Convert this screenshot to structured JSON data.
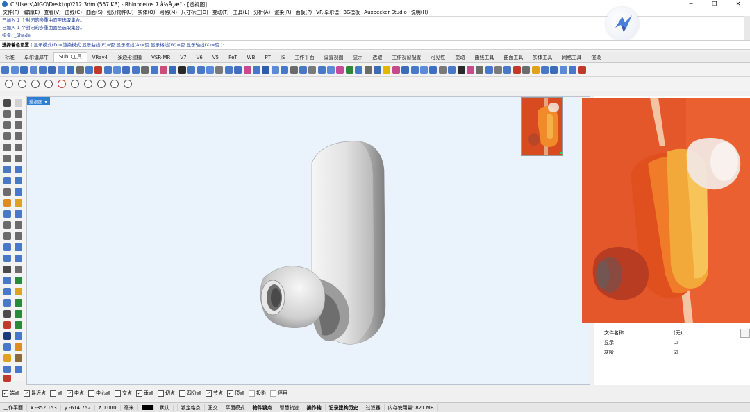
{
  "window": {
    "title": "C:\\Users\\AIGO\\Desktop\\212.3dm (557 KB) - Rhinoceros 7 å¼å¸æ° - [透视图]",
    "controls": [
      "─",
      "❐",
      "✕"
    ]
  },
  "menu": [
    "文件(F)",
    "编辑(E)",
    "查看(V)",
    "曲线(C)",
    "曲面(S)",
    "细分物件(U)",
    "实体(O)",
    "网格(M)",
    "尺寸标注(D)",
    "变动(T)",
    "工具(L)",
    "分析(A)",
    "渲染(R)",
    "面板(P)",
    "VR-卓尔谟",
    "BG模板",
    "Auxpecker Studio",
    "说明(H)"
  ],
  "command_history": [
    "已加入 1 个封闭的多重曲面至选取集合。",
    "已加入 1 个封闭的多重曲面至选取集合。",
    "指令: _Shade"
  ],
  "command_prompt": {
    "label": "选择着色设置",
    "options": "( 显示模式(D)=渲染模式  显示曲线(E)=否  显示框线(A)=否  显示格线(W)=否  显示轴线(X)=否 ):"
  },
  "tabs": [
    "标准",
    "卓尔谟犀牛",
    "SubD工具",
    "VRay4",
    "多边形建模",
    "VSR-MR",
    "V7",
    "V6",
    "V5",
    "PeT",
    "WB",
    "PT",
    "JS",
    "工作平面",
    "设置视图",
    "显示",
    "选取",
    "工作视窗配置",
    "可见性",
    "变动",
    "曲线工具",
    "曲面工具",
    "实体工具",
    "网格工具",
    "渲染"
  ],
  "active_tab": "SubD工具",
  "viewport": {
    "label": "透视图",
    "dropdown_icon": "triangle-down-icon"
  },
  "properties": [
    {
      "key": "文件名称",
      "value": "(无)",
      "has_button": true,
      "button_label": "..."
    },
    {
      "key": "显示",
      "value": "☑"
    },
    {
      "key": "灰阶",
      "value": "☑"
    }
  ],
  "osnaps": [
    {
      "label": "端点",
      "checked": true
    },
    {
      "label": "最近点",
      "checked": true
    },
    {
      "label": "点",
      "checked": false
    },
    {
      "label": "中点",
      "checked": true
    },
    {
      "label": "中心点",
      "checked": false
    },
    {
      "label": "交点",
      "checked": false
    },
    {
      "label": "垂点",
      "checked": true
    },
    {
      "label": "切点",
      "checked": false
    },
    {
      "label": "四分点",
      "checked": false
    },
    {
      "label": "节点",
      "checked": true
    },
    {
      "label": "顶点",
      "checked": true
    },
    {
      "label": "投影",
      "checked": false
    },
    {
      "label": "停用",
      "checked": false
    }
  ],
  "status": {
    "cplane": "工作平面",
    "x": "x -352.153",
    "y": "y -614.752",
    "z": "z 0.000",
    "unit": "毫米",
    "layer": "默认",
    "grid_snap": "锁定格点",
    "ortho": "正交",
    "planar": "平面模式",
    "osnap": "物件锁点",
    "smarttrack": "智慧轨迹",
    "gumball": "操作轴",
    "history": "记录建构历史",
    "filter": "过滤器",
    "memory": "内存使用量: 821 MB"
  },
  "colors": {
    "viewport_bg": "#eaf2fb",
    "viewport_label": "#2d7fd6",
    "photo_orange": "#e4572a",
    "photo_yellow": "#f3a83a",
    "model_gray": "#d9d9d9"
  }
}
